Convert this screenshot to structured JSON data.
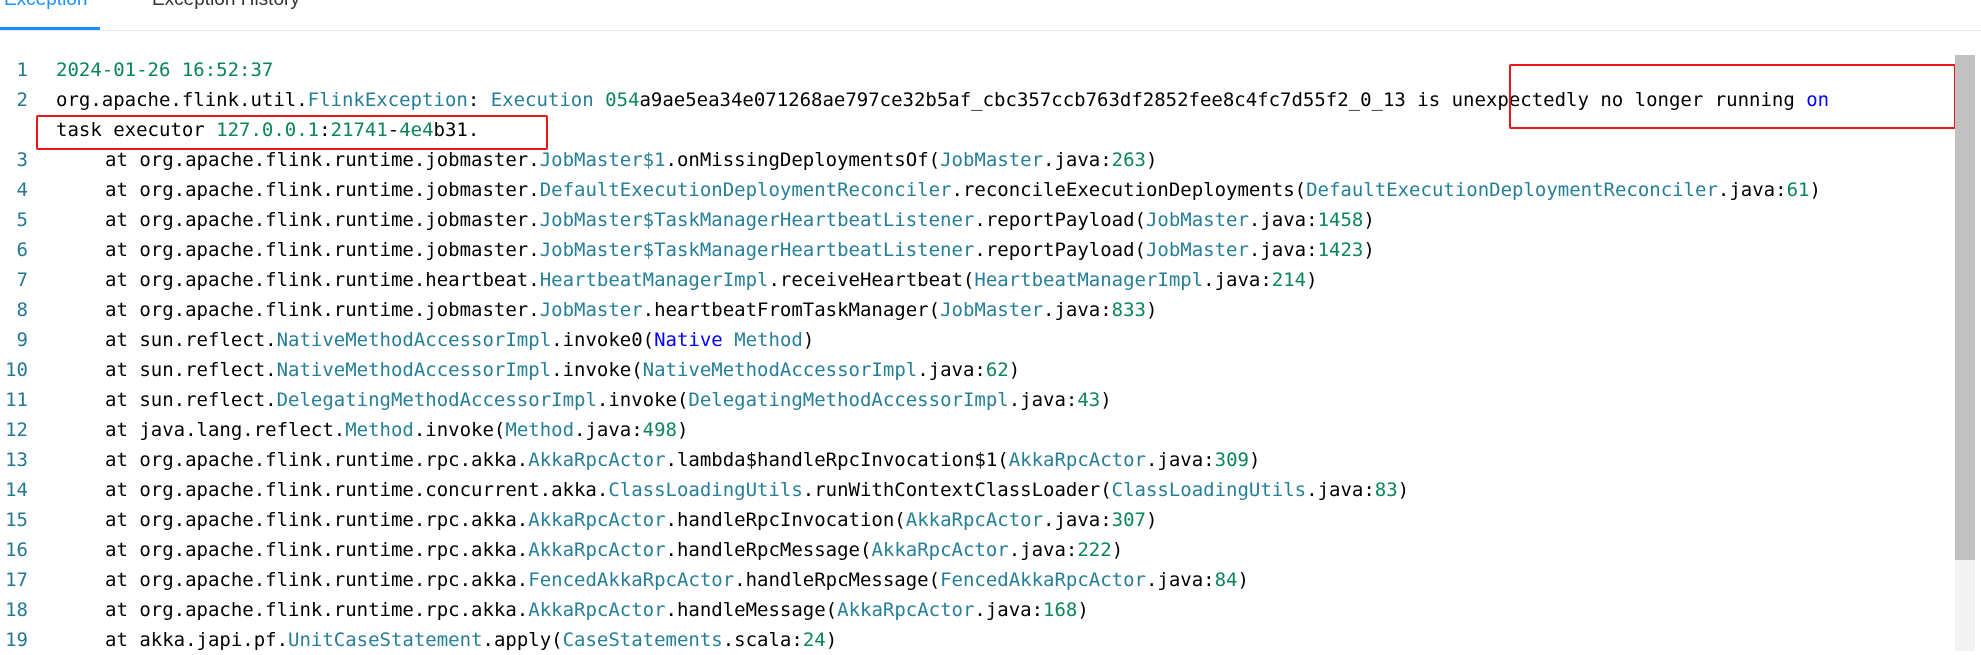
{
  "tabs": [
    {
      "label": "Exception",
      "active": true
    },
    {
      "label": "Exception History",
      "active": false
    }
  ],
  "editor": {
    "lines": [
      {
        "num": "1",
        "tokens": [
          {
            "t": "2024-01-26 16:52:37",
            "c": "num"
          }
        ]
      },
      {
        "num": "2",
        "tokens": [
          {
            "t": "org.apache.flink.util."
          },
          {
            "t": "FlinkException",
            "c": "type"
          },
          {
            "t": ": "
          },
          {
            "t": "Execution",
            "c": "type"
          },
          {
            "t": " "
          },
          {
            "t": "054",
            "c": "num"
          },
          {
            "t": "a9ae5ea34e071268ae797ce32b5af_cbc357ccb763df2852fee8c4fc7d55f2_0_13 is unexpectedly no longer running "
          },
          {
            "t": "on",
            "c": "kw"
          }
        ]
      },
      {
        "num": "",
        "tokens": [
          {
            "t": "task executor "
          },
          {
            "t": "127.0.0.1",
            "c": "num"
          },
          {
            "t": ":"
          },
          {
            "t": "21741",
            "c": "num"
          },
          {
            "t": "-"
          },
          {
            "t": "4e4",
            "c": "num"
          },
          {
            "t": "b31."
          }
        ]
      },
      {
        "num": "3",
        "indent": true,
        "tokens": [
          {
            "t": "at org.apache.flink.runtime.jobmaster."
          },
          {
            "t": "JobMaster$1",
            "c": "type"
          },
          {
            "t": ".onMissingDeploymentsOf("
          },
          {
            "t": "JobMaster",
            "c": "type"
          },
          {
            "t": ".java:"
          },
          {
            "t": "263",
            "c": "num"
          },
          {
            "t": ")"
          }
        ]
      },
      {
        "num": "4",
        "indent": true,
        "tokens": [
          {
            "t": "at org.apache.flink.runtime.jobmaster."
          },
          {
            "t": "DefaultExecutionDeploymentReconciler",
            "c": "type"
          },
          {
            "t": ".reconcileExecutionDeployments("
          },
          {
            "t": "DefaultExecutionDeploymentReconciler",
            "c": "type"
          },
          {
            "t": ".java:"
          },
          {
            "t": "61",
            "c": "num"
          },
          {
            "t": ")"
          }
        ]
      },
      {
        "num": "5",
        "indent": true,
        "tokens": [
          {
            "t": "at org.apache.flink.runtime.jobmaster."
          },
          {
            "t": "JobMaster$TaskManagerHeartbeatListener",
            "c": "type"
          },
          {
            "t": ".reportPayload("
          },
          {
            "t": "JobMaster",
            "c": "type"
          },
          {
            "t": ".java:"
          },
          {
            "t": "1458",
            "c": "num"
          },
          {
            "t": ")"
          }
        ]
      },
      {
        "num": "6",
        "indent": true,
        "tokens": [
          {
            "t": "at org.apache.flink.runtime.jobmaster."
          },
          {
            "t": "JobMaster$TaskManagerHeartbeatListener",
            "c": "type"
          },
          {
            "t": ".reportPayload("
          },
          {
            "t": "JobMaster",
            "c": "type"
          },
          {
            "t": ".java:"
          },
          {
            "t": "1423",
            "c": "num"
          },
          {
            "t": ")"
          }
        ]
      },
      {
        "num": "7",
        "indent": true,
        "tokens": [
          {
            "t": "at org.apache.flink.runtime.heartbeat."
          },
          {
            "t": "HeartbeatManagerImpl",
            "c": "type"
          },
          {
            "t": ".receiveHeartbeat("
          },
          {
            "t": "HeartbeatManagerImpl",
            "c": "type"
          },
          {
            "t": ".java:"
          },
          {
            "t": "214",
            "c": "num"
          },
          {
            "t": ")"
          }
        ]
      },
      {
        "num": "8",
        "indent": true,
        "tokens": [
          {
            "t": "at org.apache.flink.runtime.jobmaster."
          },
          {
            "t": "JobMaster",
            "c": "type"
          },
          {
            "t": ".heartbeatFromTaskManager("
          },
          {
            "t": "JobMaster",
            "c": "type"
          },
          {
            "t": ".java:"
          },
          {
            "t": "833",
            "c": "num"
          },
          {
            "t": ")"
          }
        ]
      },
      {
        "num": "9",
        "indent": true,
        "tokens": [
          {
            "t": "at sun.reflect."
          },
          {
            "t": "NativeMethodAccessorImpl",
            "c": "type"
          },
          {
            "t": ".invoke0("
          },
          {
            "t": "Native",
            "c": "kw"
          },
          {
            "t": " "
          },
          {
            "t": "Method",
            "c": "type"
          },
          {
            "t": ")"
          }
        ]
      },
      {
        "num": "10",
        "indent": true,
        "tokens": [
          {
            "t": "at sun.reflect."
          },
          {
            "t": "NativeMethodAccessorImpl",
            "c": "type"
          },
          {
            "t": ".invoke("
          },
          {
            "t": "NativeMethodAccessorImpl",
            "c": "type"
          },
          {
            "t": ".java:"
          },
          {
            "t": "62",
            "c": "num"
          },
          {
            "t": ")"
          }
        ]
      },
      {
        "num": "11",
        "indent": true,
        "tokens": [
          {
            "t": "at sun.reflect."
          },
          {
            "t": "DelegatingMethodAccessorImpl",
            "c": "type"
          },
          {
            "t": ".invoke("
          },
          {
            "t": "DelegatingMethodAccessorImpl",
            "c": "type"
          },
          {
            "t": ".java:"
          },
          {
            "t": "43",
            "c": "num"
          },
          {
            "t": ")"
          }
        ]
      },
      {
        "num": "12",
        "indent": true,
        "tokens": [
          {
            "t": "at java.lang.reflect."
          },
          {
            "t": "Method",
            "c": "type"
          },
          {
            "t": ".invoke("
          },
          {
            "t": "Method",
            "c": "type"
          },
          {
            "t": ".java:"
          },
          {
            "t": "498",
            "c": "num"
          },
          {
            "t": ")"
          }
        ]
      },
      {
        "num": "13",
        "indent": true,
        "tokens": [
          {
            "t": "at org.apache.flink.runtime.rpc.akka."
          },
          {
            "t": "AkkaRpcActor",
            "c": "type"
          },
          {
            "t": ".lambda$handleRpcInvocation$1("
          },
          {
            "t": "AkkaRpcActor",
            "c": "type"
          },
          {
            "t": ".java:"
          },
          {
            "t": "309",
            "c": "num"
          },
          {
            "t": ")"
          }
        ]
      },
      {
        "num": "14",
        "indent": true,
        "tokens": [
          {
            "t": "at org.apache.flink.runtime.concurrent.akka."
          },
          {
            "t": "ClassLoadingUtils",
            "c": "type"
          },
          {
            "t": ".runWithContextClassLoader("
          },
          {
            "t": "ClassLoadingUtils",
            "c": "type"
          },
          {
            "t": ".java:"
          },
          {
            "t": "83",
            "c": "num"
          },
          {
            "t": ")"
          }
        ]
      },
      {
        "num": "15",
        "indent": true,
        "tokens": [
          {
            "t": "at org.apache.flink.runtime.rpc.akka."
          },
          {
            "t": "AkkaRpcActor",
            "c": "type"
          },
          {
            "t": ".handleRpcInvocation("
          },
          {
            "t": "AkkaRpcActor",
            "c": "type"
          },
          {
            "t": ".java:"
          },
          {
            "t": "307",
            "c": "num"
          },
          {
            "t": ")"
          }
        ]
      },
      {
        "num": "16",
        "indent": true,
        "tokens": [
          {
            "t": "at org.apache.flink.runtime.rpc.akka."
          },
          {
            "t": "AkkaRpcActor",
            "c": "type"
          },
          {
            "t": ".handleRpcMessage("
          },
          {
            "t": "AkkaRpcActor",
            "c": "type"
          },
          {
            "t": ".java:"
          },
          {
            "t": "222",
            "c": "num"
          },
          {
            "t": ")"
          }
        ]
      },
      {
        "num": "17",
        "indent": true,
        "tokens": [
          {
            "t": "at org.apache.flink.runtime.rpc.akka."
          },
          {
            "t": "FencedAkkaRpcActor",
            "c": "type"
          },
          {
            "t": ".handleRpcMessage("
          },
          {
            "t": "FencedAkkaRpcActor",
            "c": "type"
          },
          {
            "t": ".java:"
          },
          {
            "t": "84",
            "c": "num"
          },
          {
            "t": ")"
          }
        ]
      },
      {
        "num": "18",
        "indent": true,
        "tokens": [
          {
            "t": "at org.apache.flink.runtime.rpc.akka."
          },
          {
            "t": "AkkaRpcActor",
            "c": "type"
          },
          {
            "t": ".handleMessage("
          },
          {
            "t": "AkkaRpcActor",
            "c": "type"
          },
          {
            "t": ".java:"
          },
          {
            "t": "168",
            "c": "num"
          },
          {
            "t": ")"
          }
        ]
      },
      {
        "num": "19",
        "indent": true,
        "tokens": [
          {
            "t": "at akka.japi.pf."
          },
          {
            "t": "UnitCaseStatement",
            "c": "type"
          },
          {
            "t": ".apply("
          },
          {
            "t": "CaseStatements",
            "c": "type"
          },
          {
            "t": ".scala:"
          },
          {
            "t": "24",
            "c": "num"
          },
          {
            "t": ")"
          }
        ]
      }
    ]
  },
  "colors": {
    "accent": "#1890ff",
    "highlight_box": "#e8191a",
    "number": "#098658",
    "type": "#267f99",
    "keyword": "#0000ff"
  }
}
